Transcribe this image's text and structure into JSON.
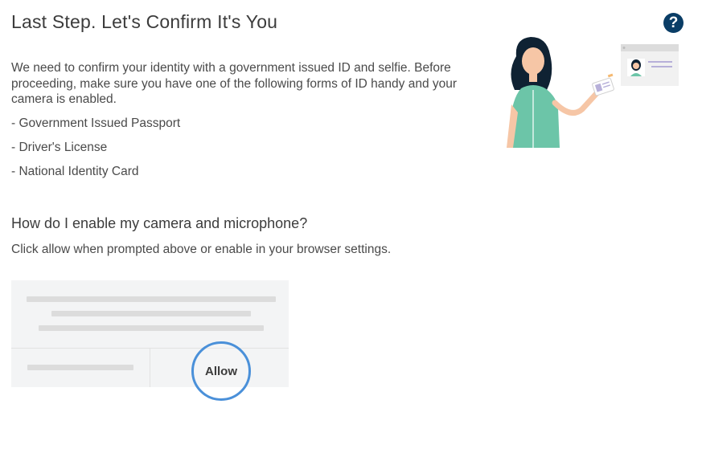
{
  "header": {
    "title": "Last Step. Let's Confirm It's You",
    "help_icon": "question-circle-icon",
    "help_symbol": "?"
  },
  "intro": {
    "text": "We need to confirm your identity with a government issued ID and selfie. Before proceeding, make sure you have one of the following forms of ID handy and your camera is enabled."
  },
  "id_options": [
    "- Government Issued Passport",
    "- Driver's License",
    "- National Identity Card"
  ],
  "camera_section": {
    "heading": "How do I enable my camera and microphone?",
    "instruction": "Click allow when prompted above or enable in your browser settings.",
    "allow_label": "Allow"
  },
  "colors": {
    "help_icon": "#0a3d66",
    "allow_ring": "#4a90d9",
    "shirt": "#6cc5a8",
    "hair": "#0f2233",
    "skin": "#f6c6a6"
  }
}
